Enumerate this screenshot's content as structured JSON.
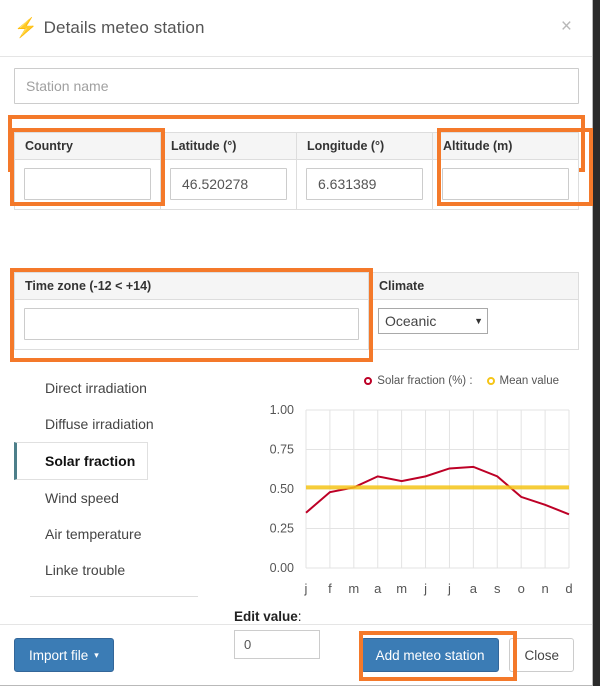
{
  "header": {
    "icon": "bolt-icon",
    "title": "Details meteo station",
    "close_label": "×"
  },
  "station_name": {
    "placeholder": "Station name",
    "value": ""
  },
  "fields": [
    {
      "label": "Country",
      "value": "",
      "highlight": true
    },
    {
      "label": "Latitude (°)",
      "value": "46.520278",
      "highlight": false
    },
    {
      "label": "Longitude (°)",
      "value": "6.631389",
      "highlight": false
    },
    {
      "label": "Altitude (m)",
      "value": "",
      "highlight": true
    }
  ],
  "timezone": {
    "label": "Time zone (-12 < +14)",
    "value": "",
    "highlight": true
  },
  "climate": {
    "label": "Climate",
    "selected": "Oceanic",
    "caret": "▼"
  },
  "tabs": [
    {
      "label": "Direct irradiation",
      "active": false
    },
    {
      "label": "Diffuse irradiation",
      "active": false
    },
    {
      "label": "Solar fraction",
      "active": true
    },
    {
      "label": "Wind speed",
      "active": false
    },
    {
      "label": "Air temperature",
      "active": false
    },
    {
      "label": "Linke trouble",
      "active": false
    }
  ],
  "edit_value": {
    "label": "Edit value",
    "colon": ":",
    "value": "0"
  },
  "footer": {
    "import_label": "Import file",
    "import_caret": "▾",
    "add_label": "Add meteo station",
    "close_label": "Close",
    "add_highlight": true
  },
  "colors": {
    "highlight": "#f4792a",
    "series": "#bd0026",
    "mean": "#f5c518",
    "primary_button": "#3b7cb5",
    "active_tab_marker": "#4d7f8a",
    "grid": "#e3e3e3"
  },
  "chart_data": {
    "type": "line",
    "title": "",
    "xlabel": "",
    "ylabel": "",
    "x": [
      "j",
      "f",
      "m",
      "a",
      "m",
      "j",
      "j",
      "a",
      "s",
      "o",
      "n",
      "d"
    ],
    "ylim": [
      0.0,
      1.0
    ],
    "yticks": [
      "0.00",
      "0.25",
      "0.50",
      "0.75",
      "1.00"
    ],
    "ytick_values": [
      0.0,
      0.25,
      0.5,
      0.75,
      1.0
    ],
    "grid": true,
    "legend_position": "top-right",
    "series": [
      {
        "name": "Solar fraction (%) :",
        "color": "#bd0026",
        "type": "line",
        "values": [
          0.35,
          0.48,
          0.51,
          0.58,
          0.55,
          0.58,
          0.63,
          0.64,
          0.58,
          0.45,
          0.4,
          0.34
        ]
      },
      {
        "name": "Mean value",
        "color": "#f5c518",
        "type": "hline",
        "value": 0.51
      }
    ]
  }
}
